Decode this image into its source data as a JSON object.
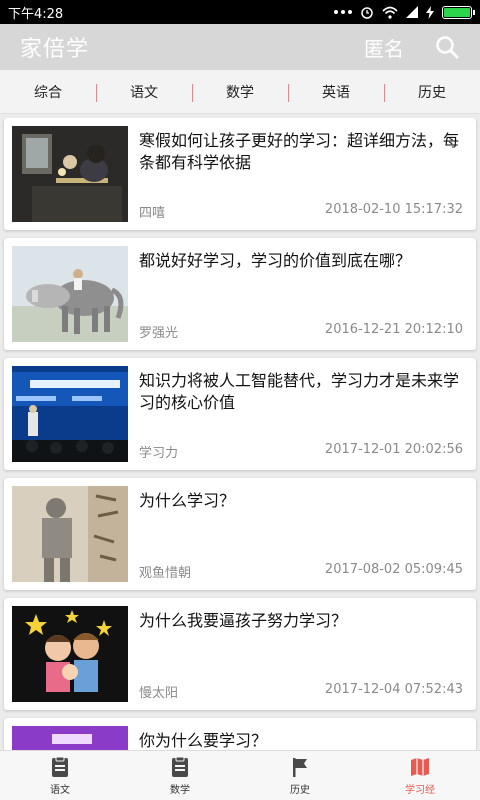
{
  "status_bar": {
    "time": "下午4:28"
  },
  "app_bar": {
    "title": "家倍学",
    "anonymous_label": "匿名"
  },
  "tabs": [
    {
      "label": "综合"
    },
    {
      "label": "语文"
    },
    {
      "label": "数学"
    },
    {
      "label": "英语"
    },
    {
      "label": "历史"
    }
  ],
  "articles": [
    {
      "title": "寒假如何让孩子更好的学习：超详细方法，每条都有科学依据",
      "author": "四嘻",
      "time": "2018-02-10 15:17:32"
    },
    {
      "title": "都说好好学习，学习的价值到底在哪？",
      "author": "罗强光",
      "time": "2016-12-21 20:12:10"
    },
    {
      "title": "知识力将被人工智能替代，学习力才是未来学习的核心价值",
      "author": "学习力",
      "time": "2017-12-01 20:02:56"
    },
    {
      "title": "为什么学习？",
      "author": "观鱼惜朝",
      "time": "2017-08-02 05:09:45"
    },
    {
      "title": "为什么我要逼孩子努力学习？",
      "author": "慢太阳",
      "time": "2017-12-04 07:52:43"
    },
    {
      "title": "你为什么要学习？",
      "author": "",
      "time": ""
    }
  ],
  "bottom_nav": [
    {
      "label": "语文",
      "icon": "document-icon",
      "active": false
    },
    {
      "label": "数学",
      "icon": "document-icon",
      "active": false
    },
    {
      "label": "历史",
      "icon": "flag-icon",
      "active": false
    },
    {
      "label": "学习经",
      "icon": "map-icon",
      "active": true
    }
  ],
  "colors": {
    "accent": "#e85b50",
    "app_bar": "#d7d7d7"
  }
}
